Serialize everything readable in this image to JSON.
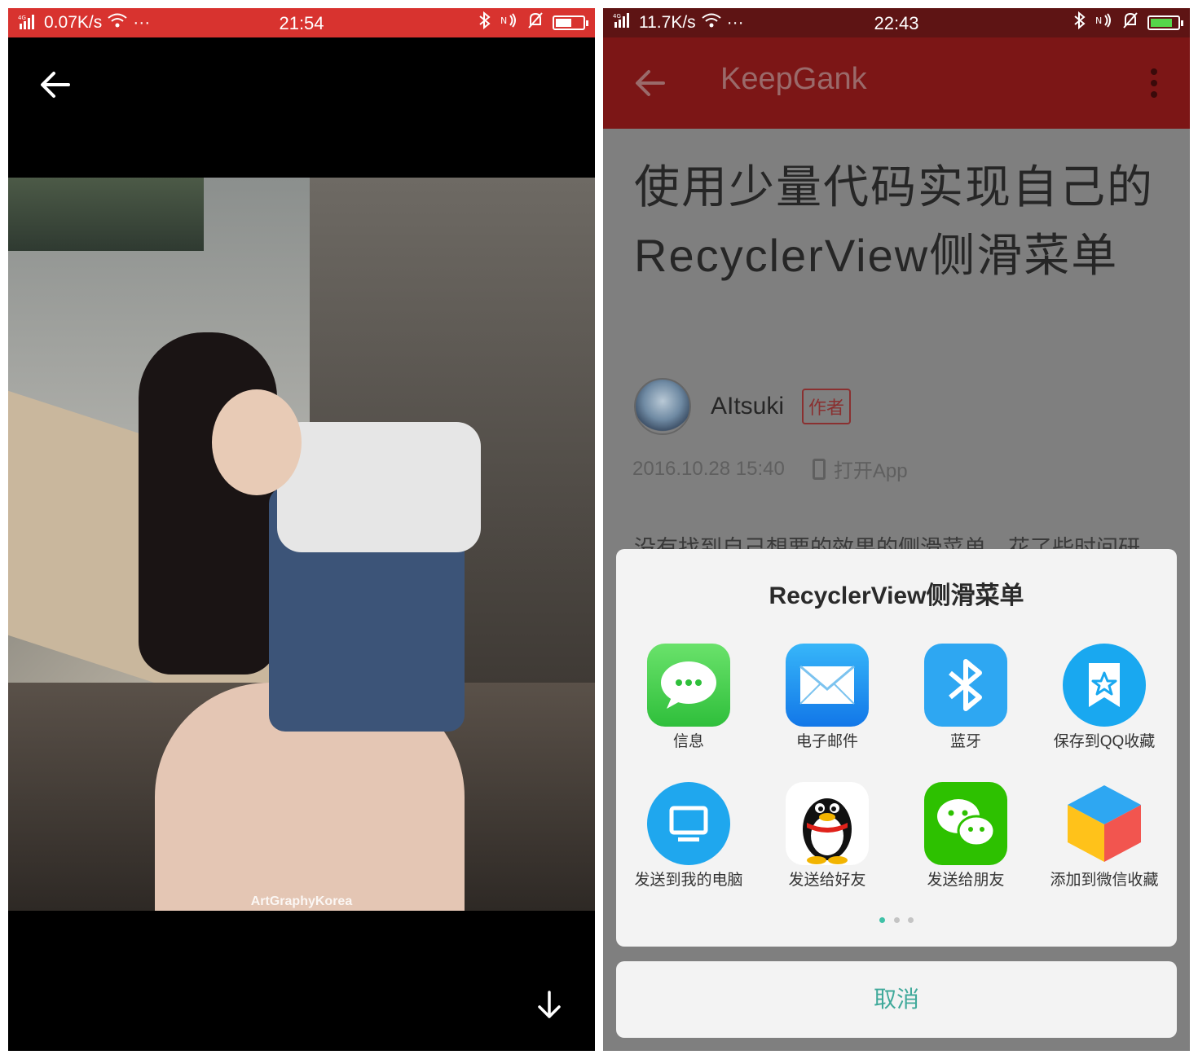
{
  "left_screen": {
    "status_bar": {
      "network": "4G",
      "speed": "0.07K/s",
      "more": "···",
      "time": "21:54",
      "battery_level": 0.6,
      "color": "#d8332f"
    },
    "photo_watermark": "ArtGraphyKorea",
    "icons": [
      "back-arrow-icon",
      "download-icon"
    ]
  },
  "right_screen": {
    "status_bar": {
      "network": "4G",
      "speed": "11.7K/s",
      "more": "···",
      "time": "22:43",
      "battery_level": 0.8,
      "charging": true
    },
    "toolbar": {
      "title": "KeepGank",
      "color": "#7c1616"
    },
    "article": {
      "title": "使用少量代码实现自己的RecyclerView侧滑菜单",
      "author": "AItsuki",
      "author_badge": "作者",
      "date": "2016.10.28 15:40",
      "open_app": "打开App",
      "body": "没有找到自己想要的效果的侧滑菜单，花了些时间研究了一下，实现的效果还行了，效果如下："
    },
    "share_sheet": {
      "title": "RecyclerView侧滑菜单",
      "items": [
        {
          "label": "信息",
          "icon": "messages-icon",
          "color": "#4cd964"
        },
        {
          "label": "电子邮件",
          "icon": "mail-icon",
          "color": "#1f9bf0"
        },
        {
          "label": "蓝牙",
          "icon": "bluetooth-icon",
          "color": "#2ea7f2"
        },
        {
          "label": "保存到QQ收藏",
          "icon": "qq-favorites-icon",
          "color": "#19a8f0"
        },
        {
          "label": "发送到我的电脑",
          "icon": "computer-icon",
          "color": "#1fa7ee"
        },
        {
          "label": "发送给好友",
          "icon": "qq-penguin-icon",
          "color": "#ffffff"
        },
        {
          "label": "发送给朋友",
          "icon": "wechat-icon",
          "color": "#2dc100"
        },
        {
          "label": "添加到微信收藏",
          "icon": "wechat-favorites-icon",
          "color": "#ffffff"
        }
      ],
      "page_count": 3,
      "active_page": 1
    },
    "cancel_label": "取消"
  }
}
